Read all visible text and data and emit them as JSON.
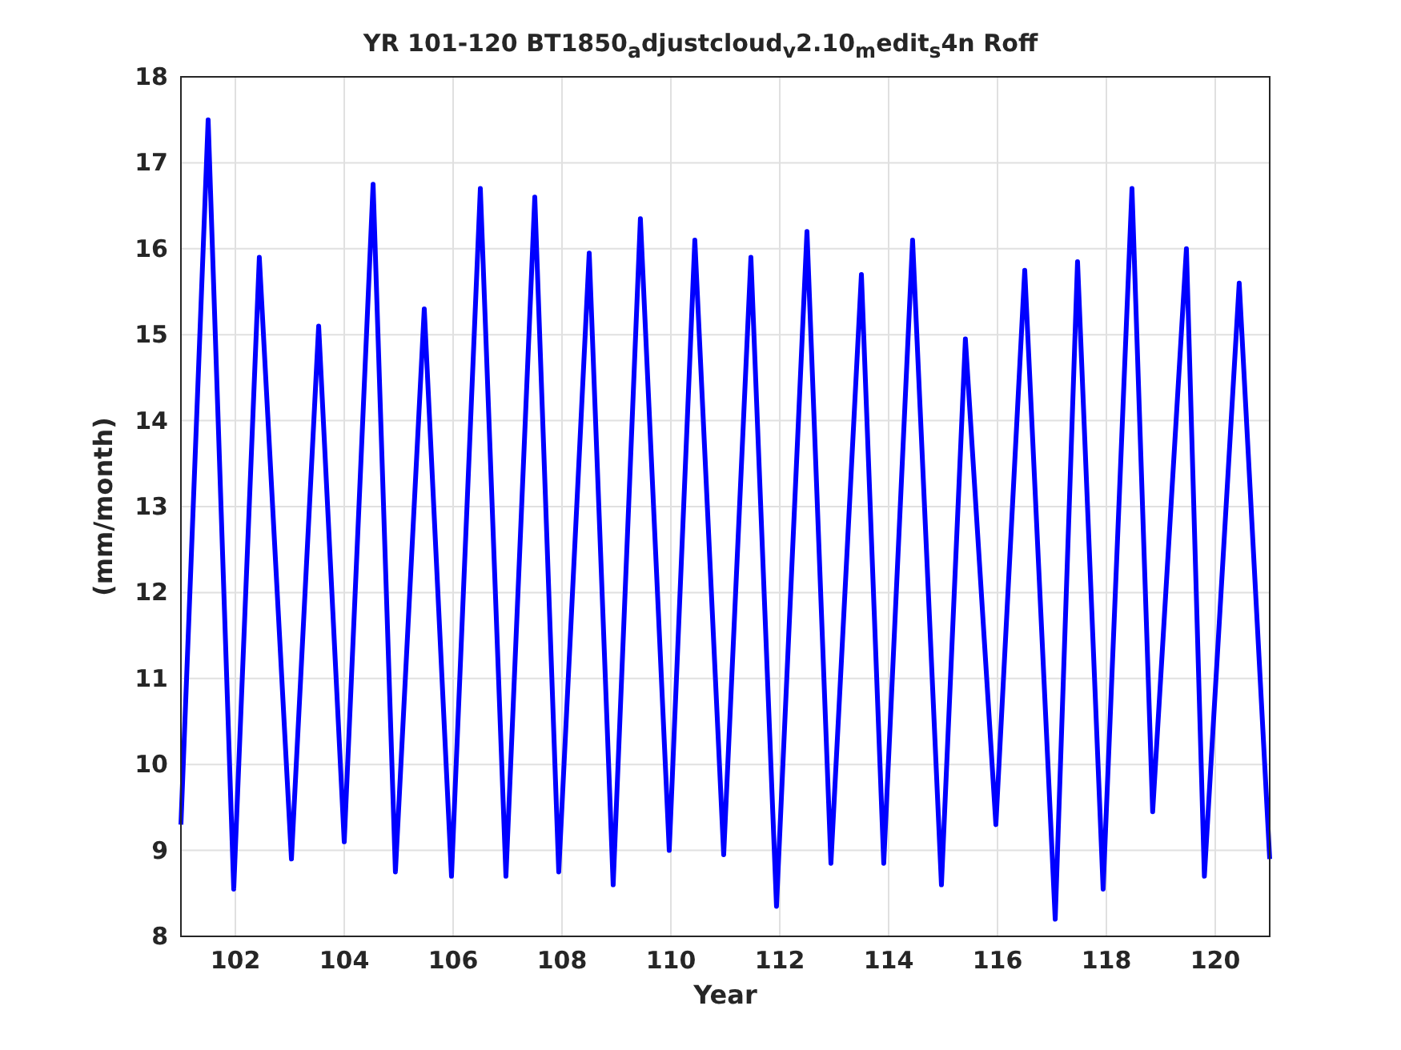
{
  "chart_data": {
    "type": "line",
    "title": "YR 101-120 BT1850$_{a}$djustcloud$_{v}$2.10$_{m}$edit$_{s}$4n Roff",
    "xlabel": "Year",
    "ylabel": "(mm/month)",
    "x": [
      101,
      101.5,
      101.97,
      102.44,
      103.03,
      103.53,
      104.0,
      104.53,
      104.94,
      105.47,
      105.97,
      106.5,
      106.97,
      107.5,
      107.94,
      108.5,
      108.94,
      109.44,
      109.97,
      110.44,
      110.97,
      111.47,
      111.94,
      112.5,
      112.94,
      113.5,
      113.91,
      114.44,
      114.97,
      115.41,
      115.97,
      116.5,
      117.06,
      117.47,
      117.94,
      118.47,
      118.85,
      119.47,
      119.8,
      120.44,
      121
    ],
    "grid": true,
    "series": [
      {
        "color": "#0000ff",
        "values": [
          9.3,
          17.5,
          8.55,
          15.9,
          8.9,
          15.1,
          9.1,
          16.75,
          8.75,
          15.3,
          8.7,
          16.7,
          8.7,
          16.6,
          8.75,
          15.95,
          8.6,
          16.35,
          9.0,
          16.1,
          8.95,
          15.9,
          8.35,
          16.2,
          8.85,
          15.7,
          8.85,
          16.1,
          8.6,
          14.95,
          9.3,
          15.75,
          8.2,
          15.85,
          8.55,
          16.7,
          9.45,
          16.0,
          8.7,
          15.6,
          8.9
        ]
      }
    ],
    "xlim": [
      101,
      121
    ],
    "ylim": [
      8,
      18
    ],
    "xticks": [
      102,
      104,
      106,
      108,
      110,
      112,
      114,
      116,
      118,
      120
    ],
    "yticks": [
      8,
      9,
      10,
      11,
      12,
      13,
      14,
      15,
      16,
      17,
      18
    ]
  }
}
